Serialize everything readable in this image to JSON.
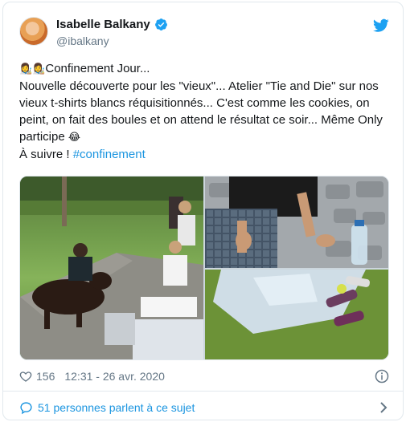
{
  "tweet": {
    "author": {
      "display_name": "Isabelle Balkany",
      "handle": "@ibalkany",
      "verified": true
    },
    "text": {
      "line1_emojis": "👩‍🎨👩‍🎨",
      "line1": "Confinement Jour...",
      "line2": "Nouvelle découverte pour les \"vieux\"... Atelier \"Tie and Die\" sur nos vieux t-shirts blancs réquisitionnés... C'est comme les cookies, on peint, on fait des boules et on attend le résultat ce soir... Même Only participe",
      "line2_emoji": "😂",
      "line3": "À suivre !",
      "hashtag": "#confinement"
    },
    "media": {
      "count": 3,
      "images": [
        "garden-dog-kids-photo",
        "tshirt-sitting-photo",
        "tarp-bottles-photo"
      ]
    },
    "likes": "156",
    "timestamp": "12:31 - 26 avr. 2020",
    "conversation_label": "51 personnes parlent à ce sujet"
  },
  "icons": {
    "verified": "verified-badge-icon",
    "twitter": "twitter-bird-icon",
    "heart": "heart-icon",
    "info": "info-icon",
    "bubble": "speech-bubble-icon",
    "chevron": "chevron-right-icon"
  },
  "colors": {
    "brand_blue": "#1da1f2",
    "link_blue": "#1b95e0",
    "text": "#14171a",
    "muted": "#657786",
    "border": "#e1e8ed"
  }
}
